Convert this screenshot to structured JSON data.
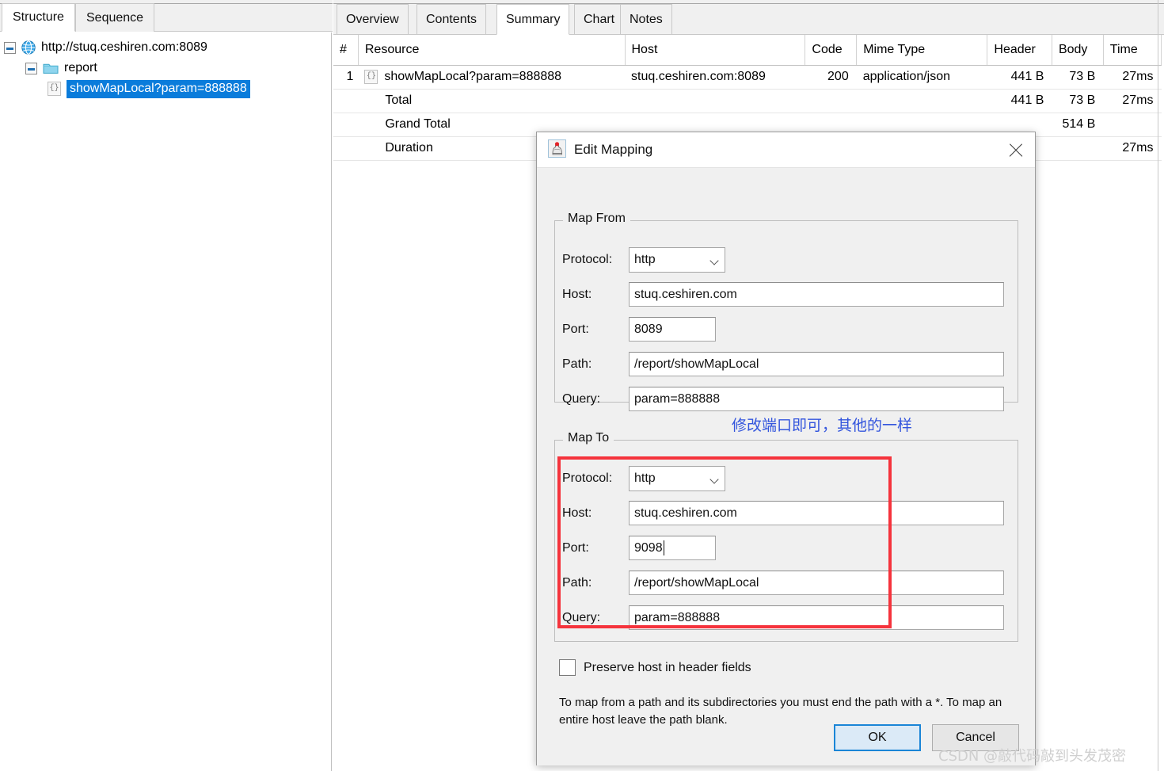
{
  "left_panel": {
    "tabs": [
      {
        "label": "Structure",
        "active": true
      },
      {
        "label": "Sequence",
        "active": false
      }
    ],
    "tree": [
      {
        "label": "http://stuq.ceshiren.com:8089",
        "icon": "globe-icon",
        "level": 0,
        "expanded": true,
        "selected": false
      },
      {
        "label": "report",
        "icon": "folder-icon",
        "level": 1,
        "expanded": true,
        "selected": false
      },
      {
        "label": "showMapLocal?param=888888",
        "icon": "json-icon",
        "level": 2,
        "expanded": false,
        "selected": true
      }
    ]
  },
  "right_panel": {
    "tabs": [
      {
        "label": "Overview",
        "active": false
      },
      {
        "label": "Contents",
        "active": false
      },
      {
        "label": "Summary",
        "active": true
      },
      {
        "label": "Chart",
        "active": false
      },
      {
        "label": "Notes",
        "active": false
      }
    ],
    "table": {
      "columns": [
        "#",
        "Resource",
        "Host",
        "Code",
        "Mime Type",
        "Header",
        "Body",
        "Time"
      ],
      "rows": [
        {
          "num": "1",
          "resource": "showMapLocal?param=888888",
          "host": "stuq.ceshiren.com:8089",
          "code": "200",
          "mime": "application/json",
          "header": "441 B",
          "body": "73 B",
          "time": "27ms"
        },
        {
          "num": "",
          "resource": "Total",
          "host": "",
          "code": "",
          "mime": "",
          "header": "441 B",
          "body": "73 B",
          "time": "27ms"
        },
        {
          "num": "",
          "resource": "Grand Total",
          "host": "",
          "code": "",
          "mime": "",
          "header": "",
          "body": "514 B",
          "time": ""
        },
        {
          "num": "",
          "resource": "Duration",
          "host": "",
          "code": "",
          "mime": "",
          "header": "",
          "body": "",
          "time": "27ms"
        }
      ]
    }
  },
  "dialog": {
    "title": "Edit Mapping",
    "icon": "charles-proxy-icon",
    "close_label": "close-icon",
    "map_from": {
      "legend": "Map From",
      "protocol_label": "Protocol:",
      "protocol_value": "http",
      "host_label": "Host:",
      "host_value": "stuq.ceshiren.com",
      "port_label": "Port:",
      "port_value": "8089",
      "path_label": "Path:",
      "path_value": "/report/showMapLocal",
      "query_label": "Query:",
      "query_value": "param=888888"
    },
    "map_to": {
      "legend": "Map To",
      "protocol_label": "Protocol:",
      "protocol_value": "http",
      "host_label": "Host:",
      "host_value": "stuq.ceshiren.com",
      "port_label": "Port:",
      "port_value": "9098",
      "path_label": "Path:",
      "path_value": "/report/showMapLocal",
      "query_label": "Query:",
      "query_value": "param=888888"
    },
    "preserve_host_label": "Preserve host in header fields",
    "preserve_host_checked": false,
    "help_text": "To map from a path and its subdirectories you must end the path with a *. To map an entire host leave the path blank.",
    "ok_label": "OK",
    "cancel_label": "Cancel"
  },
  "annotations": {
    "chinese_note": "修改端口即可，其他的一样",
    "chinese_note_color": "#3355dd",
    "highlight_box_color": "#f5333c",
    "watermark": "CSDN @敲代码敲到头发茂密"
  }
}
